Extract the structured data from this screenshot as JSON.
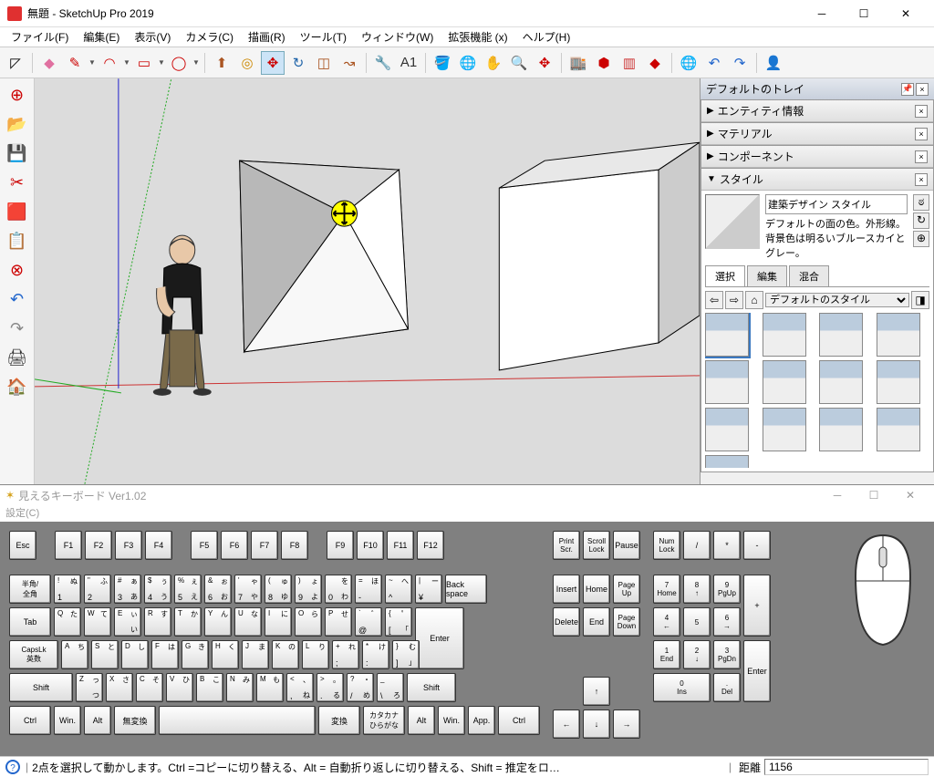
{
  "titlebar": {
    "title": "無題 - SketchUp Pro 2019"
  },
  "menus": [
    "ファイル(F)",
    "編集(E)",
    "表示(V)",
    "カメラ(C)",
    "描画(R)",
    "ツール(T)",
    "ウィンドウ(W)",
    "拡張機能 (x)",
    "ヘルプ(H)"
  ],
  "toolbar": [
    {
      "n": "select-icon",
      "g": "◸"
    },
    {
      "sep": true
    },
    {
      "n": "eraser-icon",
      "g": "◆",
      "c": "#e070a0"
    },
    {
      "n": "pencil-icon",
      "g": "✎",
      "c": "#c00",
      "dd": true
    },
    {
      "n": "arc-icon",
      "g": "◠",
      "c": "#c00",
      "dd": true
    },
    {
      "n": "rect-icon",
      "g": "▭",
      "c": "#c00",
      "dd": true
    },
    {
      "n": "circle-icon",
      "g": "◯",
      "c": "#c00",
      "dd": true
    },
    {
      "sep": true
    },
    {
      "n": "pushpull-icon",
      "g": "⬆",
      "c": "#a52"
    },
    {
      "n": "offset-icon",
      "g": "◎",
      "c": "#c80"
    },
    {
      "n": "move-icon",
      "g": "✥",
      "c": "#c00",
      "sel": true
    },
    {
      "n": "rotate-icon",
      "g": "↻",
      "c": "#26a"
    },
    {
      "n": "scale-icon",
      "g": "◫",
      "c": "#a52"
    },
    {
      "n": "followme-icon",
      "g": "↝",
      "c": "#a52"
    },
    {
      "sep": true
    },
    {
      "n": "tape-icon",
      "g": "🔧",
      "c": "#888"
    },
    {
      "n": "text-icon",
      "g": "A1",
      "c": "#333"
    },
    {
      "sep": true
    },
    {
      "n": "paint-icon",
      "g": "🪣",
      "c": "#a52"
    },
    {
      "n": "orbit-icon",
      "g": "🌐",
      "c": "#c00"
    },
    {
      "n": "pan-icon",
      "g": "✋",
      "c": "#c96"
    },
    {
      "n": "zoom-icon",
      "g": "🔍",
      "c": "#333"
    },
    {
      "n": "zoomext-icon",
      "g": "✥",
      "c": "#c00"
    },
    {
      "sep": true
    },
    {
      "n": "warehouse-icon",
      "g": "🏬",
      "c": "#c00"
    },
    {
      "n": "extwh-icon",
      "g": "⬢",
      "c": "#c00"
    },
    {
      "n": "layout-icon",
      "g": "▥",
      "c": "#c33"
    },
    {
      "n": "ruby-icon",
      "g": "◆",
      "c": "#c00"
    },
    {
      "sep": true
    },
    {
      "n": "geo-icon",
      "g": "🌐",
      "c": "#26c"
    },
    {
      "n": "undo-icon",
      "g": "↶",
      "c": "#26c"
    },
    {
      "n": "redo-icon",
      "g": "↷",
      "c": "#26c"
    },
    {
      "sep": true
    },
    {
      "n": "user-icon",
      "g": "👤",
      "c": "#888"
    }
  ],
  "leftbar": [
    {
      "n": "component-icon",
      "g": "⊕",
      "c": "#c00"
    },
    {
      "n": "open-icon",
      "g": "📂",
      "c": "#3a3"
    },
    {
      "n": "save-icon",
      "g": "💾",
      "c": "#26a"
    },
    {
      "n": "cut-icon",
      "g": "✂",
      "c": "#c00"
    },
    {
      "n": "copy-icon",
      "g": "🟥",
      "c": "#c00"
    },
    {
      "n": "paste-icon",
      "g": "📋",
      "c": "#888"
    },
    {
      "n": "delete-icon",
      "g": "⊗",
      "c": "#c00"
    },
    {
      "n": "undo2-icon",
      "g": "↶",
      "c": "#26c"
    },
    {
      "n": "redo2-icon",
      "g": "↷",
      "c": "#888"
    },
    {
      "n": "print-icon",
      "g": "🖨",
      "c": "#333"
    },
    {
      "n": "model-icon",
      "g": "🏠",
      "c": "#c00"
    }
  ],
  "tray": {
    "title": "デフォルトのトレイ",
    "panels": [
      {
        "label": "エンティティ情報",
        "open": false
      },
      {
        "label": "マテリアル",
        "open": false
      },
      {
        "label": "コンポーネント",
        "open": false
      },
      {
        "label": "スタイル",
        "open": true
      }
    ],
    "style": {
      "name": "建築デザイン スタイル",
      "desc": "デフォルトの面の色。外形線。背景色は明るいブルースカイとグレー。",
      "tabs": [
        "選択",
        "編集",
        "混合"
      ],
      "collection": "デフォルトのスタイル",
      "thumbs": 13
    }
  },
  "kbd": {
    "title": "見えるキーボード Ver1.02",
    "menu": "設定(C)",
    "row0": [
      "Esc",
      "",
      "F1",
      "F2",
      "F3",
      "F4",
      "",
      "F5",
      "F6",
      "F7",
      "F8",
      "",
      "F9",
      "F10",
      "F11",
      "F12"
    ],
    "row1l": [
      [
        "半角/",
        "全角"
      ]
    ],
    "row1": [
      [
        "!",
        "1",
        "ぬ"
      ],
      [
        "\"",
        "2",
        "ふ"
      ],
      [
        "#",
        "3",
        "ぁ",
        "あ"
      ],
      [
        "$",
        "4",
        "ぅ",
        "う"
      ],
      [
        "%",
        "5",
        "ぇ",
        "え"
      ],
      [
        "&",
        "6",
        "ぉ",
        "お"
      ],
      [
        "'",
        "7",
        "ゃ",
        "や"
      ],
      [
        "(",
        "8",
        "ゅ",
        "ゆ"
      ],
      [
        ")",
        "9",
        "ょ",
        "よ"
      ],
      [
        "",
        "0",
        "を",
        "わ"
      ],
      [
        "=",
        "-",
        "ほ"
      ],
      [
        "~",
        "^",
        "へ"
      ],
      [
        "|",
        "¥",
        "ー"
      ]
    ],
    "row1r": "Back space",
    "row2l": "Tab",
    "row2": [
      [
        "Q",
        "",
        "た"
      ],
      [
        "W",
        "",
        "て"
      ],
      [
        "E",
        "",
        "ぃ",
        "い"
      ],
      [
        "R",
        "",
        "す"
      ],
      [
        "T",
        "",
        "か"
      ],
      [
        "Y",
        "",
        "ん"
      ],
      [
        "U",
        "",
        "な"
      ],
      [
        "I",
        "",
        "に"
      ],
      [
        "O",
        "",
        "ら"
      ],
      [
        "P",
        "",
        "せ"
      ],
      [
        "`",
        "@",
        "゛"
      ],
      [
        "{",
        "[",
        "゜",
        "「"
      ]
    ],
    "row2r": "Enter",
    "row3l": [
      "CapsLk",
      "英数"
    ],
    "row3": [
      [
        "A",
        "",
        "ち"
      ],
      [
        "S",
        "",
        "と"
      ],
      [
        "D",
        "",
        "し"
      ],
      [
        "F",
        "",
        "は"
      ],
      [
        "G",
        "",
        "き"
      ],
      [
        "H",
        "",
        "く"
      ],
      [
        "J",
        "",
        "ま"
      ],
      [
        "K",
        "",
        "の"
      ],
      [
        "L",
        "",
        "り"
      ],
      [
        "+",
        ";",
        "れ"
      ],
      [
        "*",
        ":",
        "け"
      ],
      [
        "}",
        "]",
        "む",
        "」"
      ]
    ],
    "row4l": "Shift",
    "row4": [
      [
        "Z",
        "",
        "っ",
        "つ"
      ],
      [
        "X",
        "",
        "さ"
      ],
      [
        "C",
        "",
        "そ"
      ],
      [
        "V",
        "",
        "ひ"
      ],
      [
        "B",
        "",
        "こ"
      ],
      [
        "N",
        "",
        "み"
      ],
      [
        "M",
        "",
        "も"
      ],
      [
        "<",
        ",",
        "、",
        "ね"
      ],
      [
        ">",
        ".",
        "。",
        "る"
      ],
      [
        "?",
        "/",
        "・",
        "め"
      ],
      [
        "_",
        "\\",
        "",
        "ろ"
      ]
    ],
    "row4r": "Shift",
    "row5": [
      "Ctrl",
      "Win.",
      "Alt",
      "無変換",
      "",
      "変換",
      [
        "カタカナ",
        "ひらがな"
      ],
      "Alt",
      "Win.",
      "App.",
      "Ctrl"
    ],
    "nav_top": [
      [
        "Print",
        "Scr."
      ],
      [
        "Scroll",
        "Lock"
      ],
      "Pause"
    ],
    "nav1": [
      "Insert",
      "Home",
      [
        "Page",
        "Up"
      ]
    ],
    "nav2": [
      "Delete",
      "End",
      [
        "Page",
        "Down"
      ]
    ],
    "arrows": [
      "↑",
      "←",
      "↓",
      "→"
    ],
    "num_top": [
      [
        "Num",
        "Lock"
      ],
      "/",
      "*",
      "-"
    ],
    "num1": [
      [
        "7",
        "Home"
      ],
      [
        "8",
        "↑"
      ],
      [
        "9",
        "PgUp"
      ]
    ],
    "num2": [
      [
        "4",
        "←"
      ],
      [
        "5",
        ""
      ],
      [
        "6",
        "→"
      ]
    ],
    "num3": [
      [
        "1",
        "End"
      ],
      [
        "2",
        "↓"
      ],
      [
        "3",
        "PgDn"
      ]
    ],
    "num4": [
      [
        "0",
        "Ins"
      ],
      [
        ".",
        "Del"
      ]
    ],
    "num_plus": "+",
    "num_enter": "Enter"
  },
  "status": {
    "text": "2点を選択して動かします。Ctrl =コピーに切り替える、Alt = 自動折り返しに切り替える、Shift = 推定をロ…",
    "dist_label": "距離",
    "dist_value": "1156"
  }
}
